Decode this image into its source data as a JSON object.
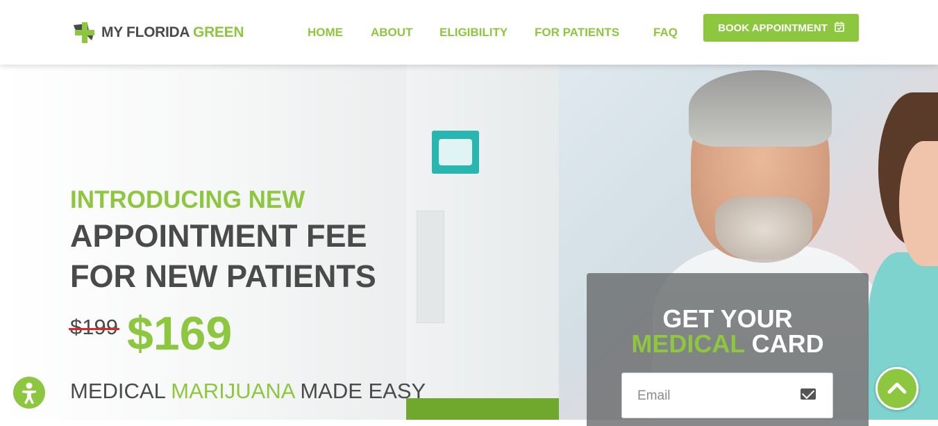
{
  "brand": {
    "name_part1": "MY FLORIDA ",
    "name_part2": "GREEN",
    "green": "#8dc63f",
    "dark": "#4a4a4a"
  },
  "nav": {
    "items": [
      {
        "label": "HOME"
      },
      {
        "label": "ABOUT"
      },
      {
        "label": "ELIGIBILITY"
      },
      {
        "label": "FOR PATIENTS"
      },
      {
        "label": "FAQ"
      }
    ],
    "book_label": "BOOK APPOINTMENT",
    "book_icon": "calendar-check-icon"
  },
  "hero": {
    "intro": "INTRODUCING NEW",
    "headline_line1": "APPOINTMENT FEE",
    "headline_line2": "FOR NEW PATIENTS",
    "old_price": "$199",
    "new_price": "$169",
    "tagline_part1": "MEDICAL ",
    "tagline_part2": "MARIJUANA",
    "tagline_part3": " MADE EASY"
  },
  "card": {
    "title_line1": "GET YOUR",
    "title_green": "MEDICAL",
    "title_rest": " CARD",
    "email_placeholder": "Email",
    "email_icon": "envelope-icon"
  },
  "floating": {
    "accessibility_icon": "accessibility-icon",
    "scroll_top_icon": "chevron-up-icon"
  }
}
